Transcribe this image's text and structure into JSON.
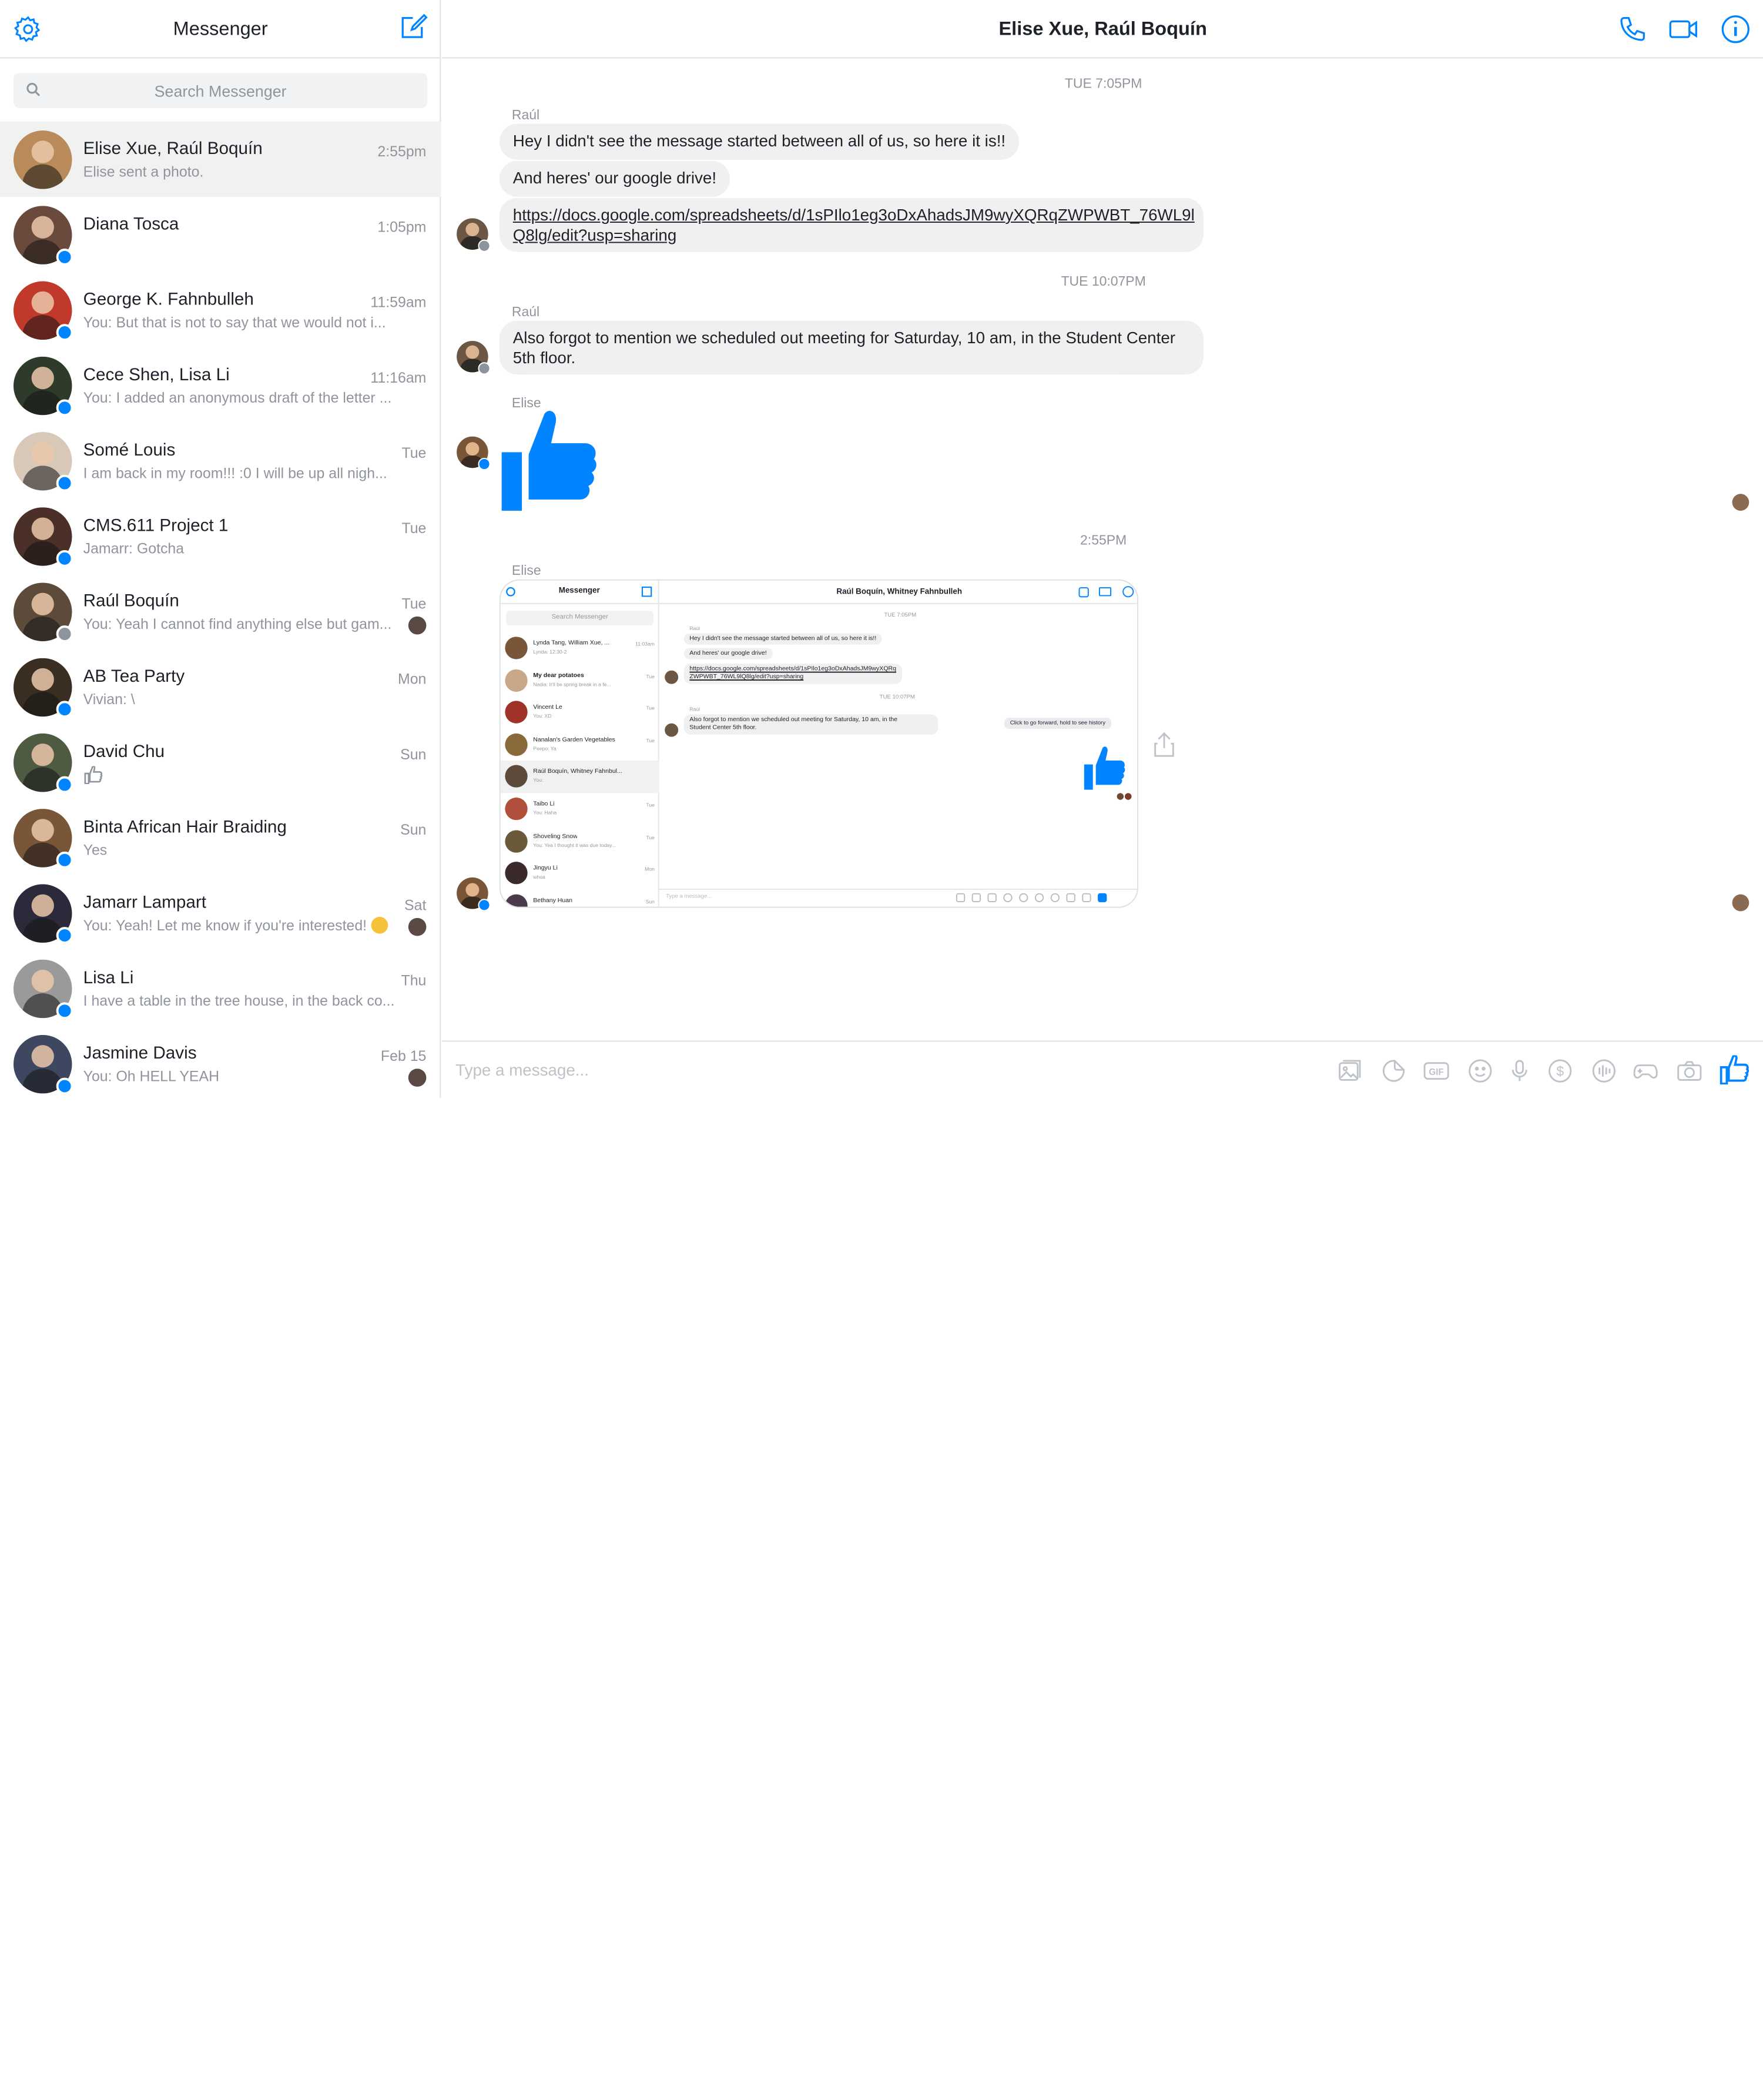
{
  "sidebar": {
    "title": "Messenger",
    "search_placeholder": "Search Messenger",
    "conversations": [
      {
        "name": "Elise Xue, Raúl Boquín",
        "snippet": "Elise sent a photo.",
        "time": "2:55pm",
        "avatar_color": "#b98a5a"
      },
      {
        "name": "Diana Tosca",
        "snippet": "",
        "time": "1:05pm",
        "avatar_color": "#6a4a3c"
      },
      {
        "name": "George K. Fahnbulleh",
        "snippet": "You: But that is not to say that we would not i...",
        "time": "11:59am",
        "avatar_color": "#c0392b"
      },
      {
        "name": "Cece Shen, Lisa Li",
        "snippet": "You: I added an anonymous draft of the letter ...",
        "time": "11:16am",
        "avatar_color": "#2f3b2a"
      },
      {
        "name": "Somé Louis",
        "snippet": "I am back in my room!!! :0 I will be up all nigh...",
        "time": "Tue",
        "avatar_color": "#d8c8b8"
      },
      {
        "name": "CMS.611 Project 1",
        "snippet": "Jamarr: Gotcha",
        "time": "Tue",
        "avatar_color": "#4a3028"
      },
      {
        "name": "Raúl Boquín",
        "snippet": "You: Yeah I cannot find anything else but gam...",
        "time": "Tue",
        "avatar_color": "#5c4a3a"
      },
      {
        "name": "AB Tea Party",
        "snippet": "Vivian: \\",
        "time": "Mon",
        "avatar_color": "#3a2e22"
      },
      {
        "name": "David Chu",
        "snippet": "",
        "time": "Sun",
        "avatar_color": "#4f5a43"
      },
      {
        "name": "Binta African Hair Braiding",
        "snippet": "Yes",
        "time": "Sun",
        "avatar_color": "#7a5638"
      },
      {
        "name": "Jamarr Lampart",
        "snippet": "You: Yeah! Let me know if you're interested!",
        "time": "Sat",
        "avatar_color": "#2b2a3a"
      },
      {
        "name": "Lisa Li",
        "snippet": "I have a table in the tree house, in the back co...",
        "time": "Thu",
        "avatar_color": "#9a9a9a"
      },
      {
        "name": "Jasmine Davis",
        "snippet": "You: Oh HELL YEAH",
        "time": "Feb 15",
        "avatar_color": "#3d4860"
      }
    ]
  },
  "chat": {
    "title": "Elise Xue, Raúl Boquín",
    "timestamps": [
      "TUE 7:05PM",
      "TUE 10:07PM",
      "2:55PM"
    ],
    "messages": [
      {
        "sender": "Raúl",
        "text": "Hey I didn't see the message started between all of us, so here it is!!"
      },
      {
        "text": "And heres' our google drive!"
      },
      {
        "link_line1": "https://docs.google.com/spreadsheets/d/1sPIlo1eg3oDxAhadsJM9wyXQRqZWPWBT_76WL9l",
        "link_line2": "Q8lg/edit?usp=sharing"
      },
      {
        "sender": "Raúl",
        "text_line1": "Also forgot to mention we scheduled out meeting for Saturday, 10 am, in the Student Center",
        "text_line2": "5th floor."
      },
      {
        "sender": "Elise",
        "type": "like"
      },
      {
        "sender": "Elise",
        "type": "photo"
      }
    ],
    "screenshot": {
      "title": "Messenger",
      "chat_title": "Raúl Boquín, Whitney Fahnbulleh",
      "search": "Search Messenger",
      "ts1": "TUE 7:05PM",
      "ts2": "TUE 10:07PM",
      "sender": "Raúl",
      "m1": "Hey I didn't see the message started between all of us, so here it is!!",
      "m2": "And heres' our google drive!",
      "m3a": "https://docs.google.com/spreadsheets/d/1sPIlo1eg3oDxAhadsJM9wyXQRq",
      "m3b": "ZWPWBT_76WL9lQ8lg/edit?usp=sharing",
      "m4a": "Also forgot to mention we scheduled out meeting for Saturday, 10 am, in the",
      "m4b": "Student Center 5th floor.",
      "tooltip": "Click to go forward, hold to see history",
      "composer": "Type a message...",
      "list": [
        {
          "name": "Lynda Tang, William Xue, ...",
          "snip": "Lynda: 12:30-2",
          "time": "11:03am"
        },
        {
          "name": "My dear potatoes",
          "snip": "Nadia: It'll be spring break in a fe...",
          "time": "Tue"
        },
        {
          "name": "Vincent Le",
          "snip": "You: XD",
          "time": "Tue"
        },
        {
          "name": "Nanalan's Garden Vegetables",
          "snip": "Peepo: Ya",
          "time": "Tue"
        },
        {
          "name": "Raúl Boquín, Whitney Fahnbul...",
          "snip": "You:",
          "time": ""
        },
        {
          "name": "Taibo Li",
          "snip": "You: Haha",
          "time": "Tue"
        },
        {
          "name": "Shoveling Snow",
          "snip": "You: Yea I thought it was due today...",
          "time": "Tue"
        },
        {
          "name": "Jingyu Li",
          "snip": "whoa",
          "time": "Mon"
        },
        {
          "name": "Bethany Huan",
          "snip": "",
          "time": "Sun"
        }
      ]
    }
  },
  "composer": {
    "placeholder": "Type a message..."
  },
  "colors": {
    "accent": "#0084ff",
    "bubble": "#f1f0f0",
    "border": "#dddfe2",
    "muted": "#90949c"
  }
}
